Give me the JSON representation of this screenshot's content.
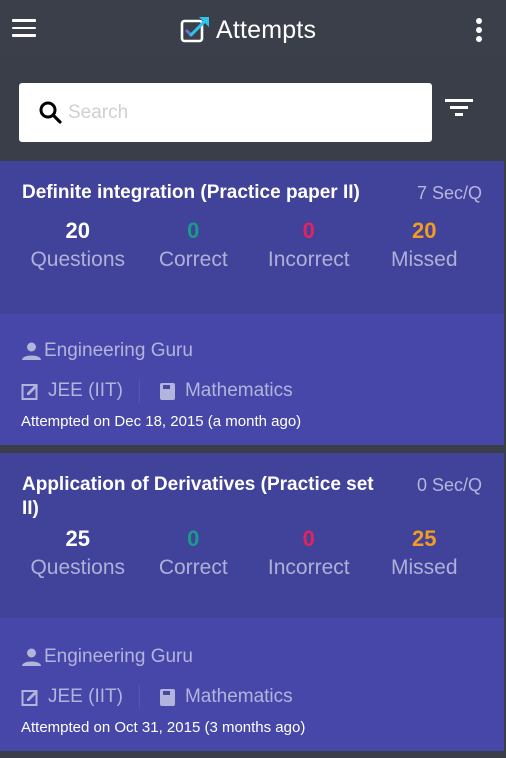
{
  "app": {
    "title": "Attempts",
    "colors": {
      "toolbar": "#3b3f49",
      "card_top": "#41429a",
      "card_bottom": "#4647a8",
      "correct": "#1a9b8a",
      "incorrect": "#e0245e",
      "missed": "#f39c21"
    }
  },
  "toolbar": {
    "menu_icon": "hamburger-menu-icon",
    "logo_icon": "checkbox-arrow-icon",
    "more_icon": "more-vertical-icon"
  },
  "search": {
    "placeholder": "Search",
    "value": "",
    "icon": "search-icon",
    "filter_icon": "filter-icon"
  },
  "attempts": [
    {
      "title": "Definite integration (Practice paper II)",
      "rate": "7 Sec/Q",
      "stats": [
        {
          "value": "20",
          "label": "Questions"
        },
        {
          "value": "0",
          "label": "Correct"
        },
        {
          "value": "0",
          "label": "Incorrect"
        },
        {
          "value": "20",
          "label": "Missed"
        }
      ],
      "author": "Engineering Guru",
      "exam": "JEE (IIT)",
      "subject": "Mathematics",
      "attempted": "Attempted on Dec 18, 2015 (a month ago)"
    },
    {
      "title": "Application of Derivatives (Practice set II)",
      "rate": "0 Sec/Q",
      "stats": [
        {
          "value": "25",
          "label": "Questions"
        },
        {
          "value": "0",
          "label": "Correct"
        },
        {
          "value": "0",
          "label": "Incorrect"
        },
        {
          "value": "25",
          "label": "Missed"
        }
      ],
      "author": "Engineering Guru",
      "exam": "JEE (IIT)",
      "subject": "Mathematics",
      "attempted": "Attempted on Oct 31, 2015 (3 months ago)"
    }
  ]
}
